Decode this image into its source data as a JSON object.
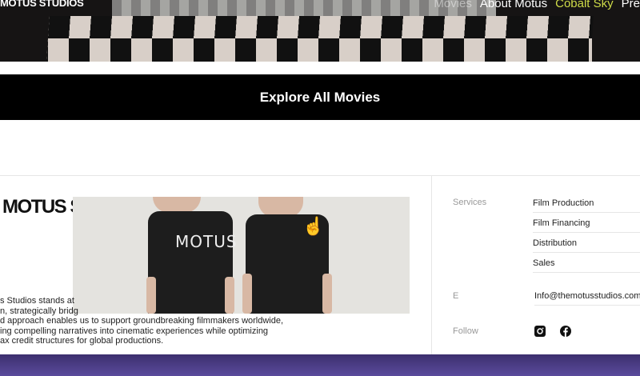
{
  "header": {
    "brand": "MOTUS STUDIOS",
    "nav": [
      "Movies",
      "About Motus",
      "Cobalt Sky",
      "Pre"
    ],
    "accent_color": "#cfdc48"
  },
  "cta": {
    "label": "Explore All Movies"
  },
  "footer": {
    "logo": "MOTUS S",
    "shirt_print": "MOTUS",
    "paragraph": [
      "s Studios stands at",
      "n, strategically bridg",
      "d approach enables us to support groundbreaking filmmakers worldwide,",
      "ing compelling narratives into cinematic experiences while optimizing",
      "ax credit structures for global productions."
    ],
    "services_label": "Services",
    "services": [
      "Film Production",
      "Film Financing",
      "Distribution",
      "Sales"
    ],
    "email_label": "E",
    "email": "Info@themotusstudios.com",
    "follow_label": "Follow",
    "social": [
      "instagram-icon",
      "facebook-icon"
    ],
    "band_color": "#4a3a8a"
  }
}
